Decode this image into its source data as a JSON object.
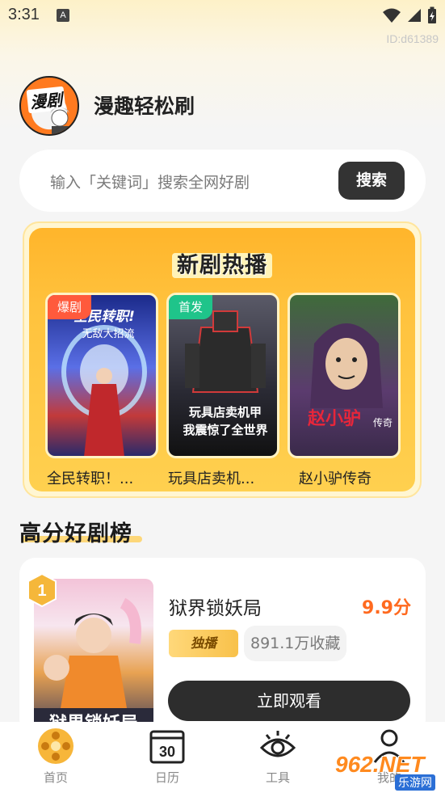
{
  "status_bar": {
    "time": "3:31",
    "notification_letter": "A"
  },
  "app_id": "ID:d61389",
  "header": {
    "logo_text": "漫剧",
    "app_name": "漫趣轻松刷"
  },
  "search": {
    "placeholder": "输入「关键词」搜索全网好剧",
    "button_label": "搜索"
  },
  "hot_section": {
    "title": "新剧热播",
    "items": [
      {
        "tag": "爆剧",
        "tag_color": "#ff5a3c",
        "title": "全民转职！...",
        "poster_text": "全民转职！无敌大招流",
        "poster_color": "#2a3b9c"
      },
      {
        "tag": "首发",
        "tag_color": "#1fc48a",
        "title": "玩具店卖机...",
        "poster_text": "玩具店卖机甲我震惊了全世界",
        "poster_color": "#3a3a44"
      },
      {
        "tag": "",
        "tag_color": "",
        "title": "赵小驴传奇",
        "poster_text": "赵小驴传奇",
        "poster_color": "#5b3b6e"
      }
    ]
  },
  "ranking": {
    "title": "高分好剧榜",
    "top_item": {
      "rank": "1",
      "name": "狱界锁妖局",
      "score": "9.9分",
      "exclusive_label": "独播",
      "collections": "891.1万收藏",
      "watch_label": "立即观看",
      "poster_text": "狱界锁妖局"
    }
  },
  "bottom_nav": {
    "items": [
      {
        "label": "首页",
        "icon": "film-reel-icon",
        "active": true
      },
      {
        "label": "日历",
        "icon": "calendar-icon",
        "active": false,
        "icon_text": "30"
      },
      {
        "label": "工具",
        "icon": "eye-icon",
        "active": false
      },
      {
        "label": "我的",
        "icon": "user-icon",
        "active": false
      }
    ]
  },
  "watermark": {
    "main": "962.NET",
    "sub": "乐游网"
  },
  "colors": {
    "accent_orange": "#ff6a1f",
    "banner_yellow": "#ffc23d",
    "dark_button": "#2d2d2d"
  }
}
